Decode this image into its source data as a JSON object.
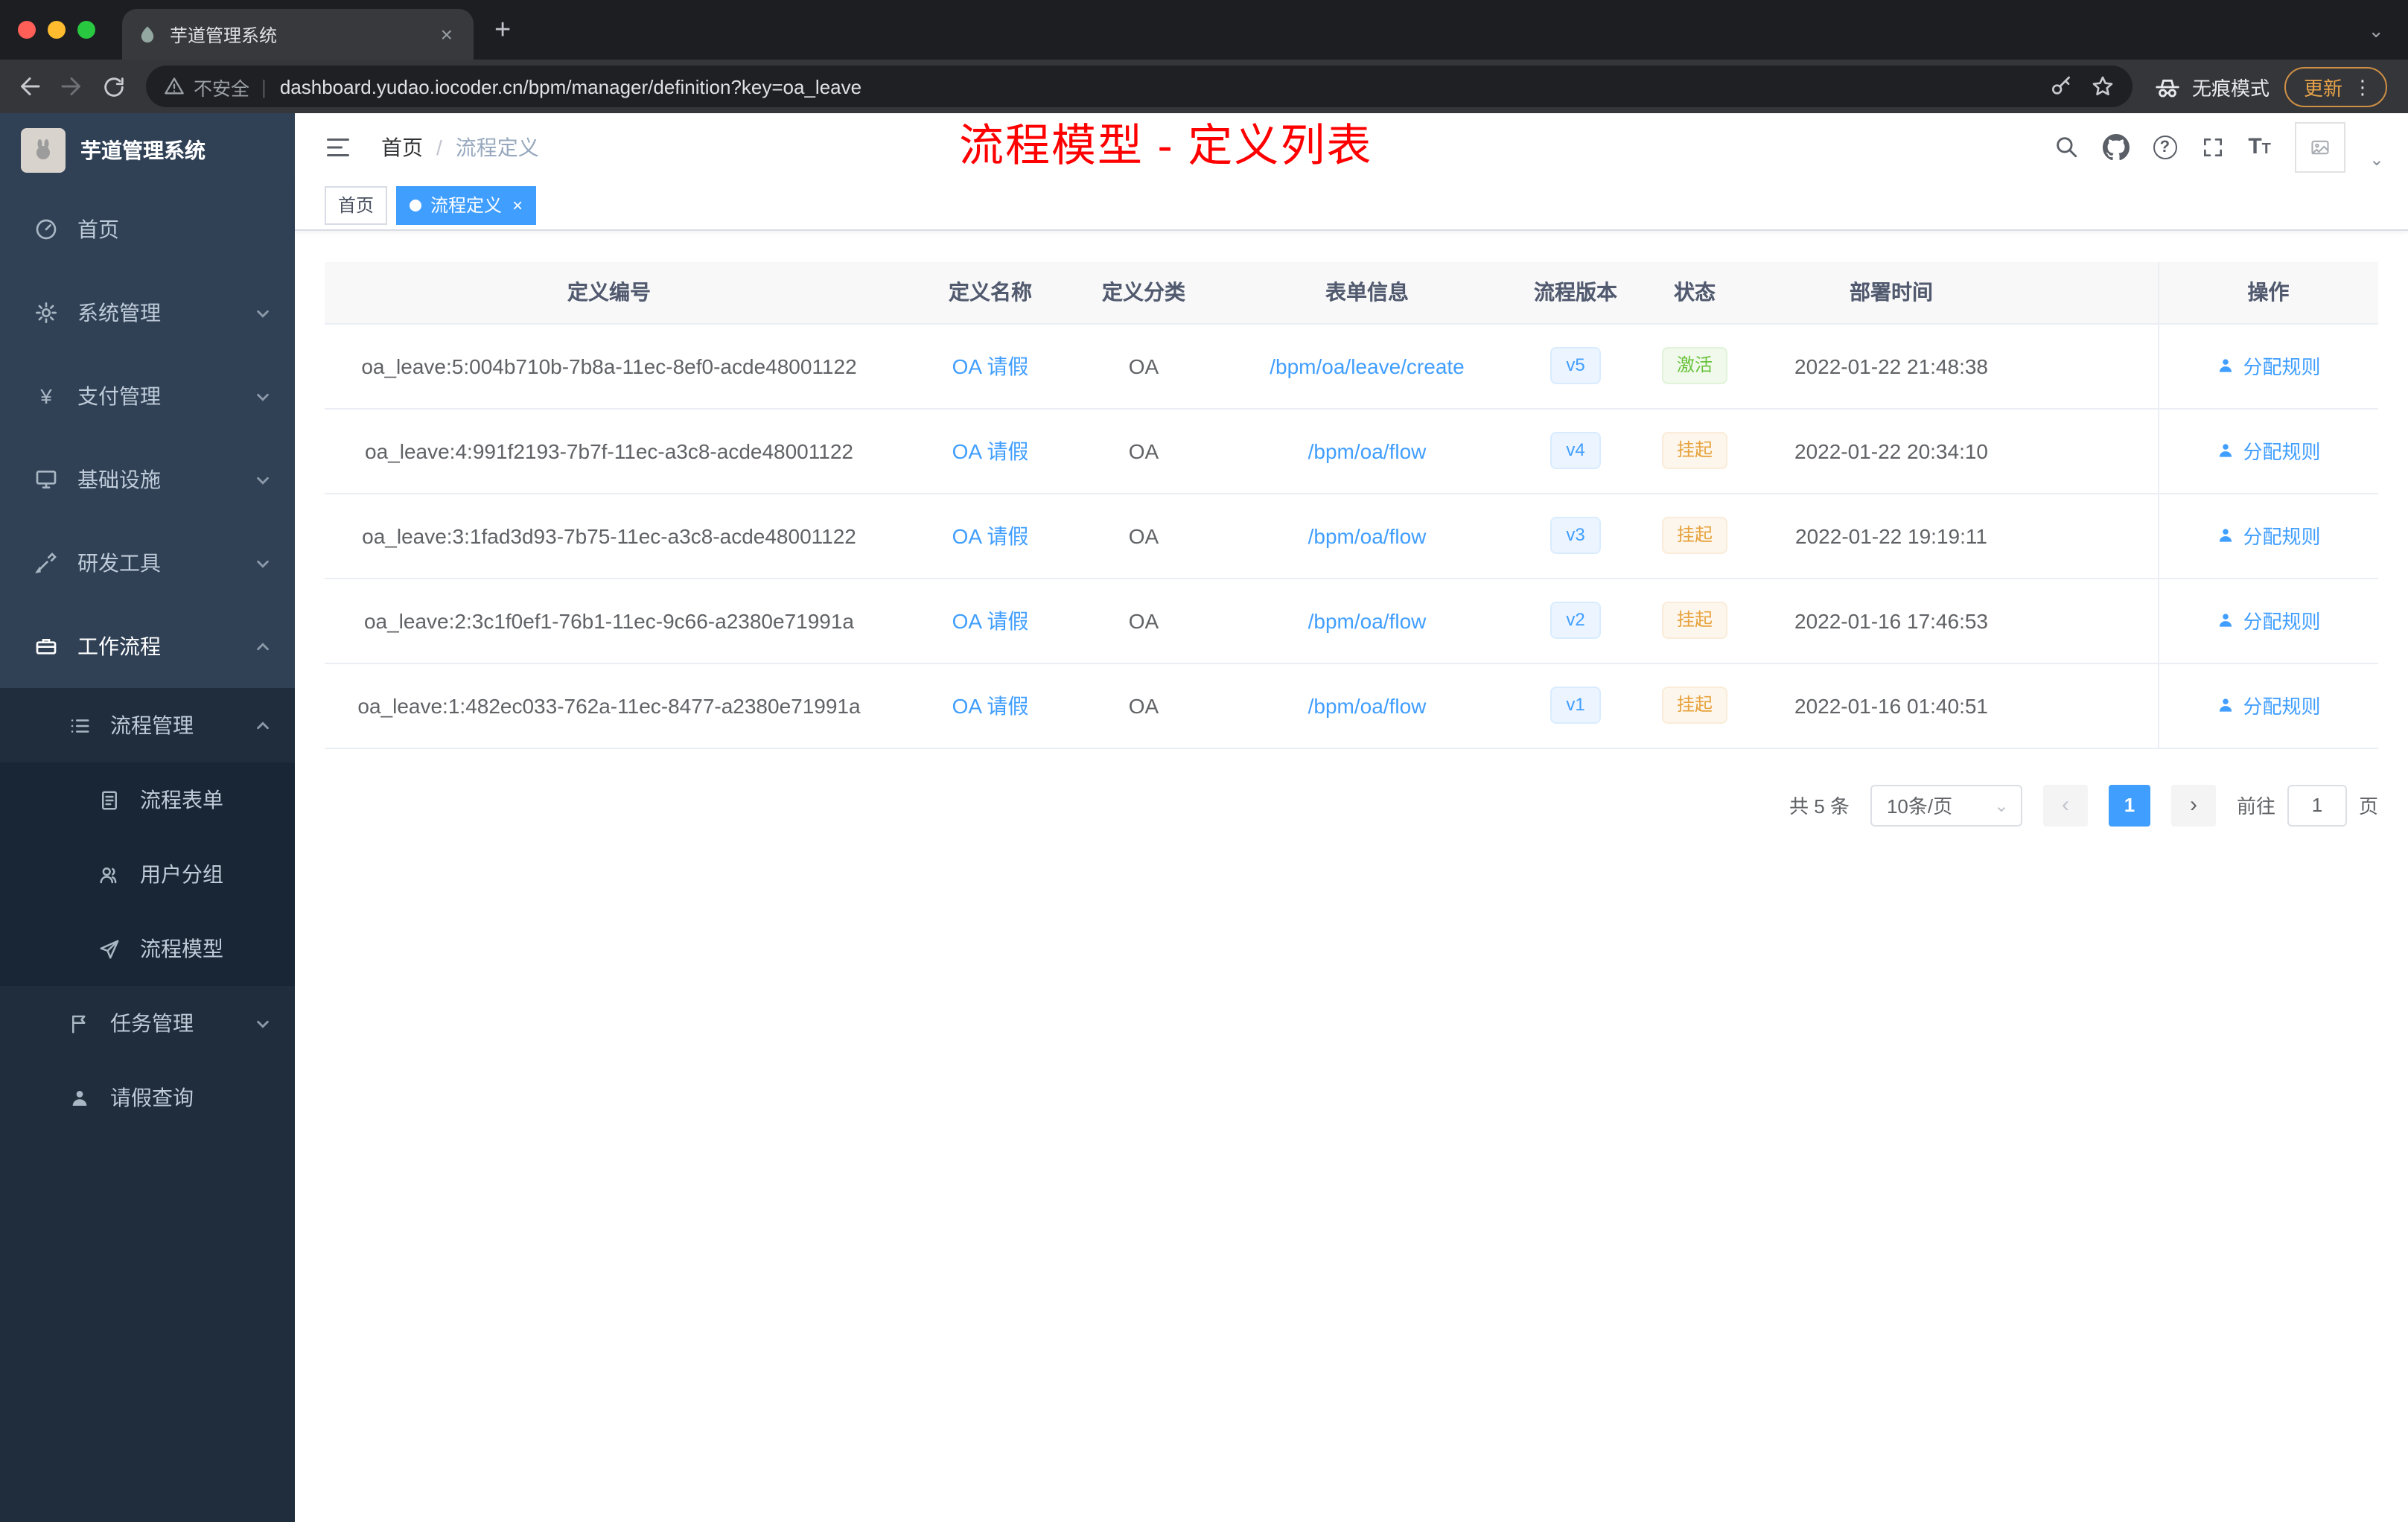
{
  "browser": {
    "tab_title": "芋道管理系统",
    "security_label": "不安全",
    "url": "dashboard.yudao.iocoder.cn/bpm/manager/definition?key=oa_leave",
    "incognito_label": "无痕模式",
    "update_label": "更新"
  },
  "glyphs": {
    "close": "×",
    "plus": "+",
    "kebab": "⋮",
    "caret_down": "⌄",
    "divider": "|",
    "question": "?",
    "font_large": "T",
    "font_small": "T",
    "yen": "¥",
    "prev": "‹",
    "next": "›"
  },
  "sidebar": {
    "app_title": "芋道管理系统",
    "items": [
      {
        "label": "首页"
      },
      {
        "label": "系统管理"
      },
      {
        "label": "支付管理"
      },
      {
        "label": "基础设施"
      },
      {
        "label": "研发工具"
      },
      {
        "label": "工作流程"
      },
      {
        "label": "流程管理"
      },
      {
        "label": "流程表单"
      },
      {
        "label": "用户分组"
      },
      {
        "label": "流程模型"
      },
      {
        "label": "任务管理"
      },
      {
        "label": "请假查询"
      }
    ]
  },
  "header": {
    "breadcrumb_home": "首页",
    "breadcrumb_sep": "/",
    "breadcrumb_current": "流程定义",
    "overlay_title": "流程模型 - 定义列表"
  },
  "tags": {
    "home": "首页",
    "active": "流程定义"
  },
  "table": {
    "columns": [
      "定义编号",
      "定义名称",
      "定义分类",
      "表单信息",
      "流程版本",
      "状态",
      "部署时间",
      "操作"
    ],
    "action_label": "分配规则",
    "rows": [
      {
        "id": "oa_leave:5:004b710b-7b8a-11ec-8ef0-acde48001122",
        "name": "OA 请假",
        "category": "OA",
        "form": "/bpm/oa/leave/create",
        "version": "v5",
        "status": "激活",
        "status_type": "success",
        "time": "2022-01-22 21:48:38"
      },
      {
        "id": "oa_leave:4:991f2193-7b7f-11ec-a3c8-acde48001122",
        "name": "OA 请假",
        "category": "OA",
        "form": "/bpm/oa/flow",
        "version": "v4",
        "status": "挂起",
        "status_type": "warning",
        "time": "2022-01-22 20:34:10"
      },
      {
        "id": "oa_leave:3:1fad3d93-7b75-11ec-a3c8-acde48001122",
        "name": "OA 请假",
        "category": "OA",
        "form": "/bpm/oa/flow",
        "version": "v3",
        "status": "挂起",
        "status_type": "warning",
        "time": "2022-01-22 19:19:11"
      },
      {
        "id": "oa_leave:2:3c1f0ef1-76b1-11ec-9c66-a2380e71991a",
        "name": "OA 请假",
        "category": "OA",
        "form": "/bpm/oa/flow",
        "version": "v2",
        "status": "挂起",
        "status_type": "warning",
        "time": "2022-01-16 17:46:53"
      },
      {
        "id": "oa_leave:1:482ec033-762a-11ec-8477-a2380e71991a",
        "name": "OA 请假",
        "category": "OA",
        "form": "/bpm/oa/flow",
        "version": "v1",
        "status": "挂起",
        "status_type": "warning",
        "time": "2022-01-16 01:40:51"
      }
    ]
  },
  "pagination": {
    "total": "共 5 条",
    "page_size": "10条/页",
    "current": "1",
    "goto_label": "前往",
    "goto_value": "1",
    "page_suffix": "页"
  },
  "colors": {
    "accent": "#409eff",
    "success": "#67c23a",
    "warning": "#e6a23c",
    "annotation_red": "#fe0000"
  }
}
